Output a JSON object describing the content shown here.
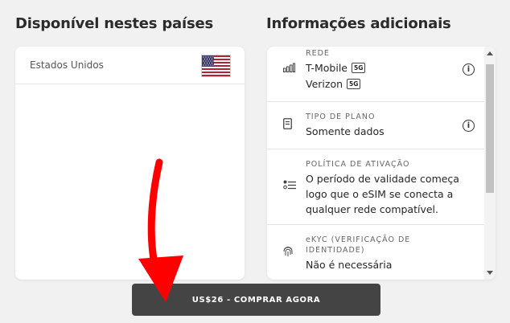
{
  "countries_section": {
    "title": "Disponível nestes países",
    "countries": [
      {
        "name": "Estados Unidos",
        "flag_icon": "us-flag-icon"
      }
    ]
  },
  "info_section": {
    "title": "Informações adicionais",
    "network": {
      "label": "REDE",
      "carriers": [
        {
          "name": "T-Mobile",
          "badge": "5G"
        },
        {
          "name": "Verizon",
          "badge": "5G"
        }
      ]
    },
    "plan_type": {
      "label": "TIPO DE PLANO",
      "value": "Somente dados"
    },
    "activation_policy": {
      "label": "POLÍTICA DE ATIVAÇÃO",
      "value_lines": [
        "O período de validade começa",
        "logo que o eSIM se conecta a",
        "qualquer rede compatível."
      ]
    },
    "ekyc": {
      "label_lines": [
        "eKYC (VERIFICAÇÃO DE",
        "IDENTIDADE)"
      ],
      "value": "Não é necessária"
    }
  },
  "buy_button": {
    "label": "US$26 - COMPRAR AGORA"
  },
  "colors": {
    "button": "#444444",
    "arrow": "#ff0000",
    "background": "#f1f1f1"
  }
}
